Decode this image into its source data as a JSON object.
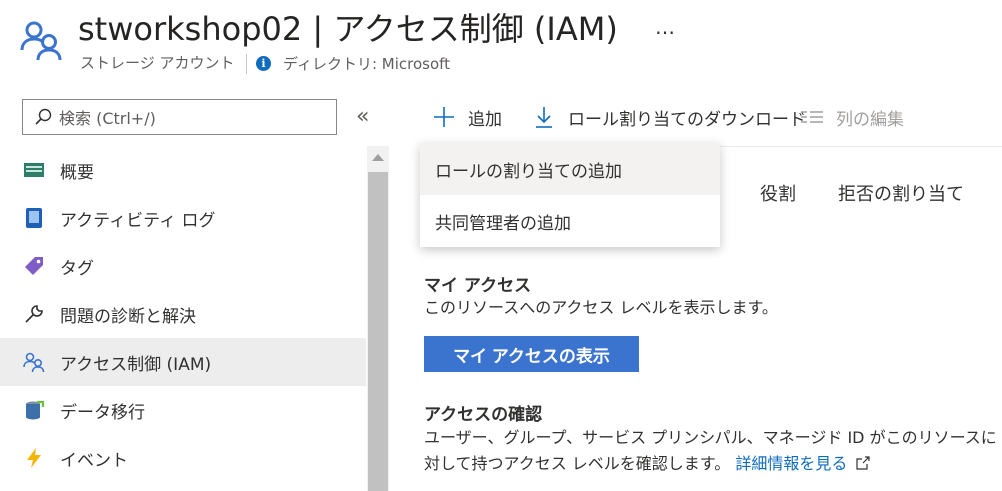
{
  "header": {
    "title": "stworkshop02 | アクセス制御 (IAM)",
    "more": "…",
    "resource_type": "ストレージ アカウント",
    "directory": "ディレクトリ: Microsoft"
  },
  "sidebar": {
    "search_placeholder": "検索 (Ctrl+/)",
    "collapse": "«",
    "items": [
      {
        "label": "概要",
        "icon": "overview-icon"
      },
      {
        "label": "アクティビティ ログ",
        "icon": "activity-log-icon"
      },
      {
        "label": "タグ",
        "icon": "tag-icon"
      },
      {
        "label": "問題の診断と解決",
        "icon": "wrench-icon"
      },
      {
        "label": "アクセス制御 (IAM)",
        "icon": "people-icon",
        "active": true
      },
      {
        "label": "データ移行",
        "icon": "data-migration-icon"
      },
      {
        "label": "イベント",
        "icon": "lightning-icon"
      }
    ]
  },
  "toolbar": {
    "add_label": "追加",
    "download_label": "ロール割り当てのダウンロード",
    "edit_columns_label": "列の編集"
  },
  "tabs": {
    "roles": "役割",
    "deny": "拒否の割り当て"
  },
  "dropdown": {
    "items": [
      {
        "label": "ロールの割り当ての追加"
      },
      {
        "label": "共同管理者の追加"
      }
    ]
  },
  "my_access": {
    "title": "マイ アクセス",
    "description": "このリソースへのアクセス レベルを表示します。",
    "button": "マイ アクセスの表示"
  },
  "check_access": {
    "title": "アクセスの確認",
    "line1": "ユーザー、グループ、サービス プリンシパル、マネージド ID がこのリソースに",
    "line2": "対して持つアクセス レベルを確認します。",
    "link": "詳細情報を見る"
  },
  "colors": {
    "accent": "#3b74cf",
    "link": "#0f6cbd",
    "active_bg": "#ededed"
  }
}
